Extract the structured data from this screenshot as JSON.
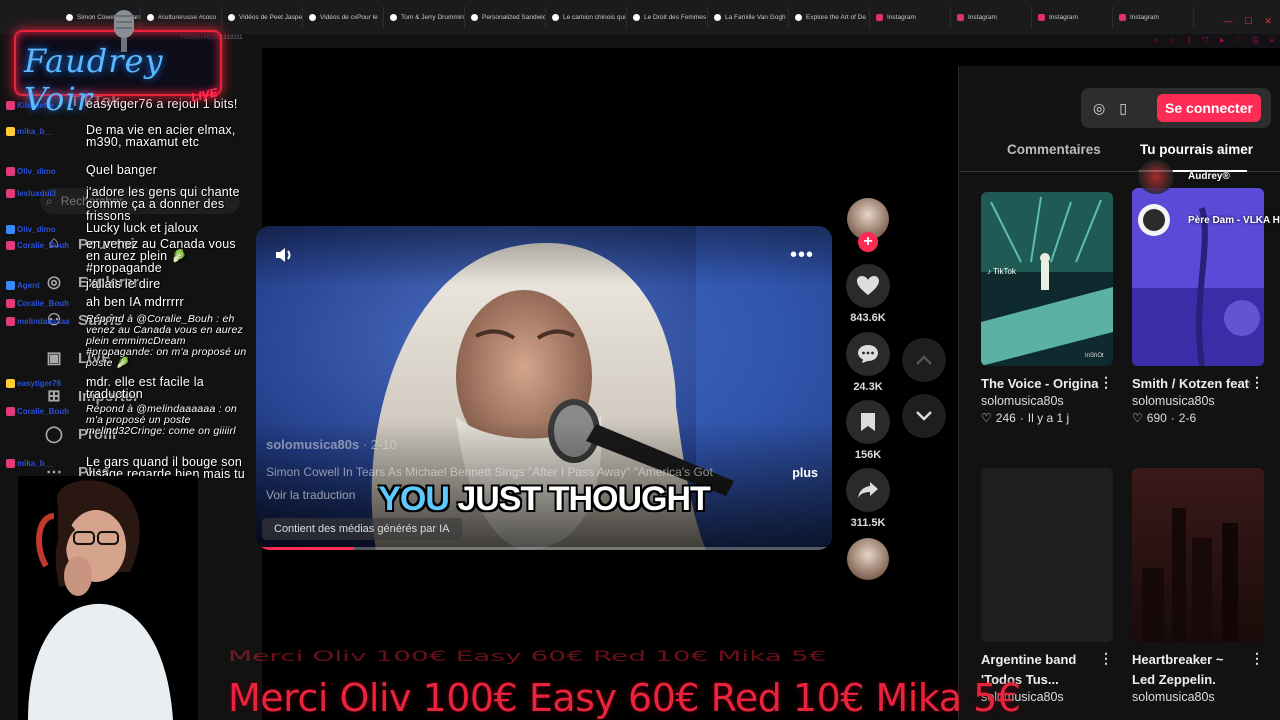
{
  "browser": {
    "tabs": [
      {
        "label": "Simon Cowell In Tears",
        "kind": "tiktok"
      },
      {
        "label": "#culturerusse #coco",
        "kind": "tiktok"
      },
      {
        "label": "Vidéos de Peet Jasper",
        "kind": "tiktok"
      },
      {
        "label": "Vidéos de cxPour le",
        "kind": "tiktok"
      },
      {
        "label": "Tom & Jerry Drumming",
        "kind": "tiktok"
      },
      {
        "label": "Personalized Sandwich",
        "kind": "tiktok"
      },
      {
        "label": "Le camion chinois qui",
        "kind": "tiktok"
      },
      {
        "label": "Le Droit des Femmes",
        "kind": "tiktok"
      },
      {
        "label": "La Famille Van Gogh",
        "kind": "tiktok"
      },
      {
        "label": "Explore the Art of De",
        "kind": "tiktok"
      },
      {
        "label": "Instagram",
        "kind": "instagram"
      },
      {
        "label": "Instagram",
        "kind": "instagram"
      },
      {
        "label": "Instagram",
        "kind": "instagram"
      },
      {
        "label": "Instagram",
        "kind": "instagram"
      }
    ],
    "address": "7553431461591319111"
  },
  "stream": {
    "logo_text": "Faudrey Voir",
    "live_label": "LIVE"
  },
  "leftnav": {
    "logo": "TikTok",
    "search_placeholder": "Rechercher",
    "items": [
      {
        "label": "Pour toi",
        "icon": "home-icon"
      },
      {
        "label": "Explorer",
        "icon": "compass-icon"
      },
      {
        "label": "Suivis",
        "icon": "users-icon"
      },
      {
        "label": "LIVE",
        "icon": "live-icon"
      },
      {
        "label": "Importer",
        "icon": "upload-icon"
      },
      {
        "label": "Profil",
        "icon": "profile-icon"
      },
      {
        "label": "Plus",
        "icon": "more-icon"
      }
    ]
  },
  "chat": [
    {
      "user": "Kilometre",
      "text": "easytiger76 a rejoui 1 bits!",
      "reply": false,
      "hl": false
    },
    {
      "user": "mika_b__",
      "text": "De ma vie en acier elmax, m390, maxamut etc",
      "reply": false,
      "hl": false
    },
    {
      "user": "Oliv_dimo",
      "text": "Quel banger",
      "reply": false,
      "hl": false
    },
    {
      "user": "lesluxdui3",
      "text": "j'adore les gens qui chante comme ça a donner des frissons",
      "reply": false,
      "hl": false
    },
    {
      "user": "Oliv_dimo",
      "text": "Lucky luck et jaloux",
      "reply": false,
      "hl": false
    },
    {
      "user": "Coralie_Bouh",
      "text": "en venez au Canada vous en aurez plein 🥬 #propagande",
      "reply": false,
      "hl": false
    },
    {
      "user": "Agent",
      "text": "j'allais le dire",
      "reply": false,
      "hl": false
    },
    {
      "user": "Coralie_Bouh",
      "text": "ah ben IA mdrrrrr",
      "reply": false,
      "hl": false
    },
    {
      "user": "melindaaaaaa",
      "text": "Répond à @Coralie_Bouh : eh venez au Canada vous en aurez plein emmimcDream #propagande: on m'a proposé un poste 🥬",
      "reply": true,
      "hl": false
    },
    {
      "user": "easytiger76",
      "text": "mdr. elle est facile la traduction",
      "reply": false,
      "hl": false
    },
    {
      "user": "Coralie_Bouh",
      "text": "Répond à @melindaaaaaa : on m'a proposé un poste melind32Cringe: come on giiiirl",
      "reply": true,
      "hl": false
    },
    {
      "user": "mika_b__",
      "text": "Le gars quand il bouge son visage regarde bien mais tu as des glitch",
      "reply": false,
      "hl": false
    }
  ],
  "video": {
    "author": "solomusica80s",
    "date": " · 2-10",
    "description": "Simon Cowell In Tears As Michael Bennett Sings \"After I Pass Away\" \"America's Got",
    "more_label": "plus",
    "translate_label": "Voir la traduction",
    "caption_word1": "YOU",
    "caption_rest": " JUST THOUGHT",
    "ai_label": "Contient des médias générés par IA",
    "progress": 0.17
  },
  "actions": {
    "likes": "843.6K",
    "comments": "24.3K",
    "saves": "156K",
    "shares": "311.5K"
  },
  "rightpanel": {
    "login_label": "Se connecter",
    "tab_comments": "Commentaires",
    "tab_suggest": "Tu pourrais aimer",
    "overlay_user1": "Audrey®",
    "overlay_user2": "Père Dam - VLKA H",
    "cards": [
      {
        "title": "The Voice - Original theme b...",
        "author": "solomusica80s",
        "likes": "246",
        "age": "Il y a 1 j"
      },
      {
        "title": "Smith / Kotzen featuring Nicko...",
        "author": "solomusica80s",
        "likes": "690",
        "age": "2-6"
      },
      {
        "title": "Argentine band 'Todos Tus...",
        "author": "solomusica80s",
        "likes": "",
        "age": ""
      },
      {
        "title": "Heartbreaker ~ Led Zeppelin.",
        "author": "solomusica80s",
        "likes": "",
        "age": ""
      }
    ]
  },
  "ticker": {
    "ghost": "Merci  Oliv 100€  Easy 60€  Red 10€  Mika 5€",
    "text": "Merci  Oliv 100€  Easy 60€  Red 10€  Mika 5€"
  },
  "colors": {
    "accent": "#fe2c55",
    "overlay_red": "#e8233b",
    "logo_blue": "#5ab8ff"
  }
}
